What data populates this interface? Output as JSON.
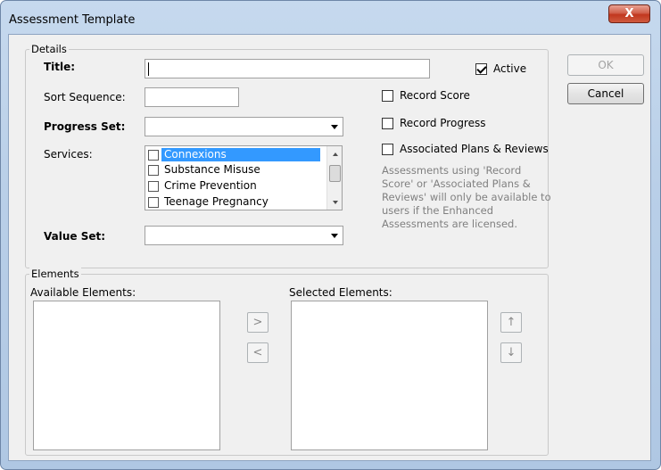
{
  "window": {
    "title": "Assessment Template",
    "close_glyph": "X"
  },
  "details": {
    "legend": "Details",
    "title_label": "Title:",
    "title_value": "",
    "active_label": "Active",
    "active_checked": true,
    "sort_label": "Sort Sequence:",
    "sort_value": "",
    "record_score_label": "Record Score",
    "record_progress_label": "Record Progress",
    "associated_label": "Associated Plans & Reviews",
    "progress_set_label": "Progress Set:",
    "progress_set_value": "",
    "services_label": "Services:",
    "services": [
      {
        "label": "Connexions",
        "checked": false,
        "selected": true
      },
      {
        "label": "Substance Misuse",
        "checked": false,
        "selected": false
      },
      {
        "label": "Crime Prevention",
        "checked": false,
        "selected": false
      },
      {
        "label": "Teenage Pregnancy",
        "checked": false,
        "selected": false
      }
    ],
    "note_lines": [
      "Assessments using 'Record",
      "Score' or 'Associated Plans &",
      "Reviews' will only be available to",
      "users if the Enhanced",
      "Assessments  are licensed."
    ],
    "value_set_label": "Value Set:",
    "value_set_value": ""
  },
  "elements": {
    "legend": "Elements",
    "available_label": "Available Elements:",
    "selected_label": "Selected Elements:",
    "add_glyph": ">",
    "remove_glyph": "<",
    "up_glyph": "↑",
    "down_glyph": "↓"
  },
  "buttons": {
    "ok_label": "OK",
    "cancel_label": "Cancel"
  },
  "colors": {
    "selection": "#3399ff",
    "close_button": "#c1371f",
    "note_text": "#808080"
  }
}
